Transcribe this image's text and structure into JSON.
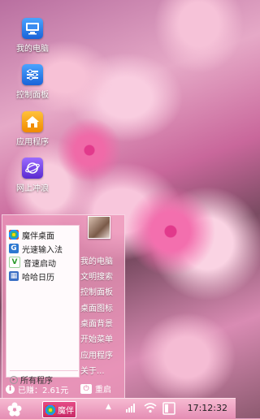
{
  "desktop": {
    "icons": [
      {
        "label": "我的电脑",
        "icon": "computer-icon"
      },
      {
        "label": "控制面板",
        "icon": "control-panel-icon"
      },
      {
        "label": "应用程序",
        "icon": "home-icon"
      },
      {
        "label": "网上冲浪",
        "icon": "globe-icon"
      }
    ]
  },
  "start_menu": {
    "programs": [
      {
        "label": "魔伴桌面",
        "icon": "pinwheel-icon"
      },
      {
        "label": "光速输入法",
        "icon": "g-input-icon"
      },
      {
        "label": "音速启动",
        "icon": "v-launcher-icon"
      },
      {
        "label": "哈哈日历",
        "icon": "calendar-icon"
      }
    ],
    "all_programs": "所有程序",
    "right_items": [
      "我的电脑",
      "文明搜索",
      "控制面板",
      "桌面图标",
      "桌面背景",
      "开始菜单",
      "应用程序",
      "关于..."
    ],
    "earned": "已赚：2.61元",
    "restart": "重启"
  },
  "taskbar": {
    "task_label": "魔伴",
    "clock": "17:12:32"
  },
  "colors": {
    "accent": "#e54b86",
    "taskbar": "#f3a8c8"
  }
}
